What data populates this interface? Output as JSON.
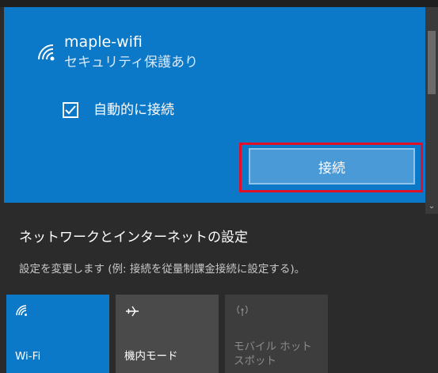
{
  "network": {
    "name": "maple-wifi",
    "security": "セキュリティ保護あり",
    "auto_connect_label": "自動的に接続",
    "auto_connect_checked": true,
    "connect_button_label": "接続"
  },
  "settings": {
    "title": "ネットワークとインターネットの設定",
    "description": "設定を変更します (例: 接続を従量制課金接続に設定する)。"
  },
  "quick_actions": [
    {
      "label": "Wi-Fi",
      "icon": "wifi-icon",
      "active": true
    },
    {
      "label": "機内モード",
      "icon": "airplane-icon",
      "active": false
    },
    {
      "label": "モバイル ホットスポット",
      "icon": "hotspot-icon",
      "active": false,
      "disabled": true
    }
  ],
  "colors": {
    "accent": "#0c78c8",
    "highlight": "#e0102a",
    "background": "#2b2b2b"
  }
}
